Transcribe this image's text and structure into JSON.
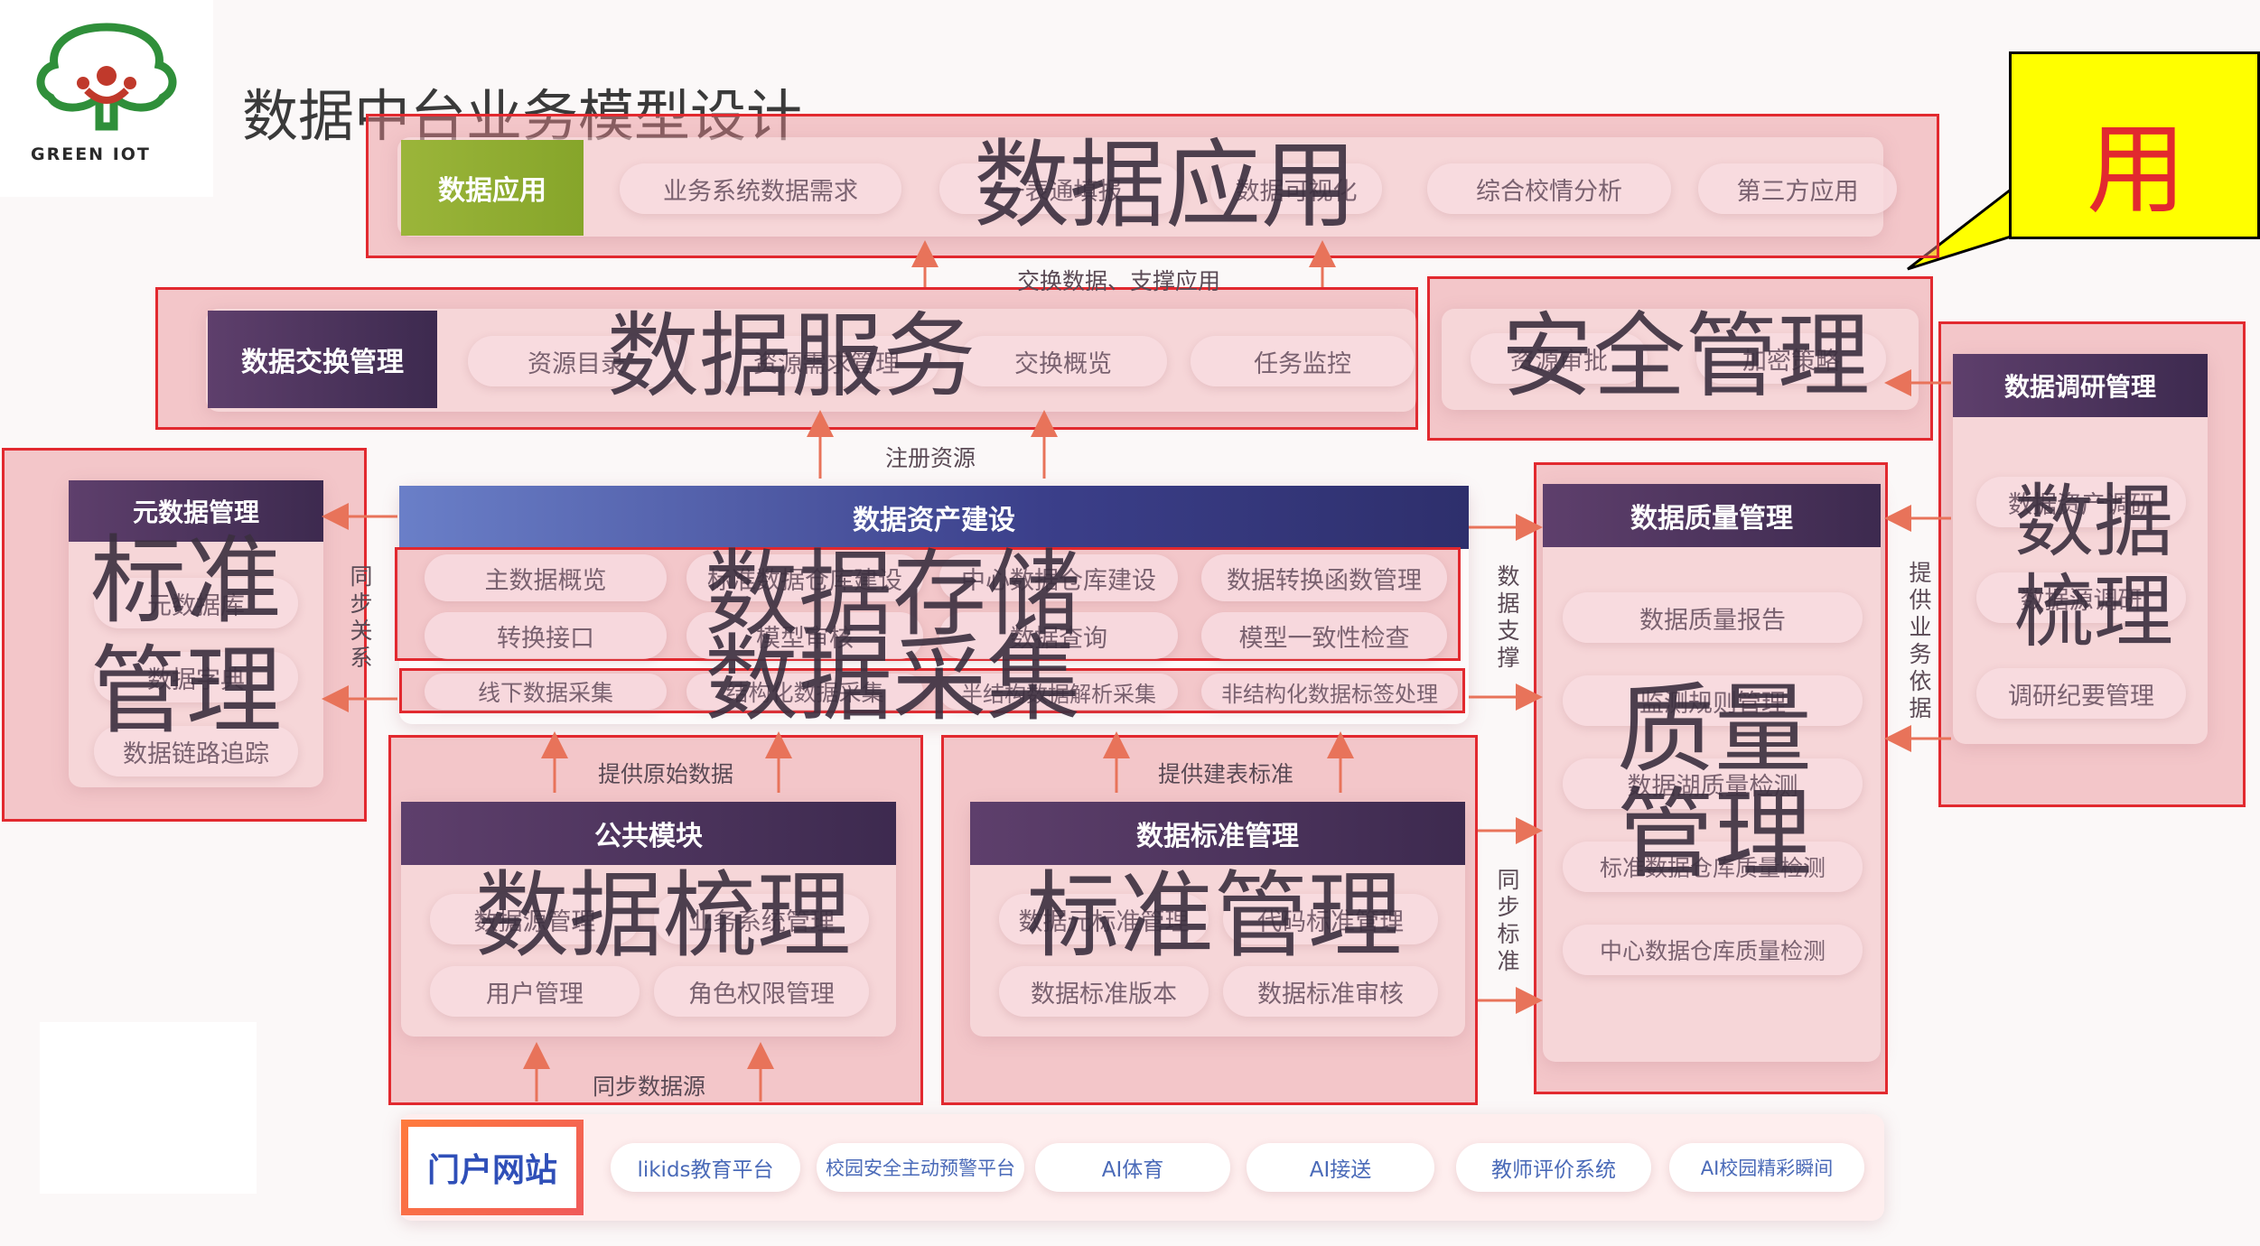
{
  "logo": {
    "text": "GREEN  IOT",
    "icon": "tree-people-logo"
  },
  "title": "数据中台业务模型设计",
  "callout": {
    "text": "用"
  },
  "app_layer": {
    "header": "数据应用",
    "items": [
      "业务系统数据需求",
      "一表通填报",
      "数据可视化",
      "综合校情分析",
      "第三方应用"
    ],
    "overlay": "数据应用"
  },
  "service_layer": {
    "header": "数据交换管理",
    "items": [
      "资源目录",
      "资源需求管理",
      "交换概览",
      "任务监控"
    ],
    "overlay": "数据服务"
  },
  "security": {
    "items": [
      "资源审批",
      "加密策略"
    ],
    "overlay": "安全管理"
  },
  "metadata": {
    "header": "元数据管理",
    "items": [
      "元数据库",
      "数据字典",
      "数据链路追踪"
    ],
    "overlay": [
      "标准",
      "管理"
    ]
  },
  "asset": {
    "header": "数据资产建设",
    "row1": [
      "主数据概览",
      "标准数据仓库建设",
      "中心数据仓库建设",
      "数据转换函数管理"
    ],
    "row2": [
      "转换接口",
      "模型审核",
      "数据查询",
      "模型一致性检查"
    ],
    "row3": [
      "线下数据采集",
      "结构化数据采集",
      "半结构数据解析采集",
      "非结构化数据标签处理"
    ],
    "overlay_storage": "数据存储",
    "overlay_collect": "数据采集"
  },
  "quality": {
    "header": "数据质量管理",
    "items": [
      "数据质量报告",
      "监测规则管理",
      "数据湖质量检测",
      "标准数据仓库质量检测",
      "中心数据仓库质量检测"
    ],
    "overlay": [
      "质量",
      "管理"
    ]
  },
  "research": {
    "header": "数据调研管理",
    "items": [
      "数据资产调研",
      "数据源调研",
      "调研纪要管理"
    ],
    "overlay": [
      "数据",
      "梳理"
    ]
  },
  "public_module": {
    "header": "公共模块",
    "items": [
      "数据源管理",
      "业务系统管理",
      "用户管理",
      "角色权限管理"
    ],
    "overlay": "数据梳理"
  },
  "standard_mgmt": {
    "header": "数据标准管理",
    "items": [
      "数据元标准管理",
      "代码标准管理",
      "数据标准版本",
      "数据标准审核"
    ],
    "overlay": "标准管理"
  },
  "portal": {
    "header": "门户网站",
    "items": [
      "likids教育平台",
      "校园安全主动预警平台",
      "AI体育",
      "AI接送",
      "教师评价系统",
      "AI校园精彩瞬间"
    ]
  },
  "flows": {
    "exchange": "交换数据、支撑应用",
    "register": "注册资源",
    "raw_data": "提供原始数据",
    "table_std": "提供建表标准",
    "sync_source": "同步数据源",
    "sync_relation": "同步关系",
    "data_support": "数据支撑",
    "biz_basis": "提供业务依据",
    "sync_std": "同步标准"
  },
  "colors": {
    "region_fill": "#e88a90",
    "region_border": "#e2292f",
    "header_purple": "#5e3f6c",
    "header_green": "#9bb53a",
    "header_blue": "#3b3f8a",
    "arrow": "#e8735a",
    "callout": "#ffff00"
  }
}
